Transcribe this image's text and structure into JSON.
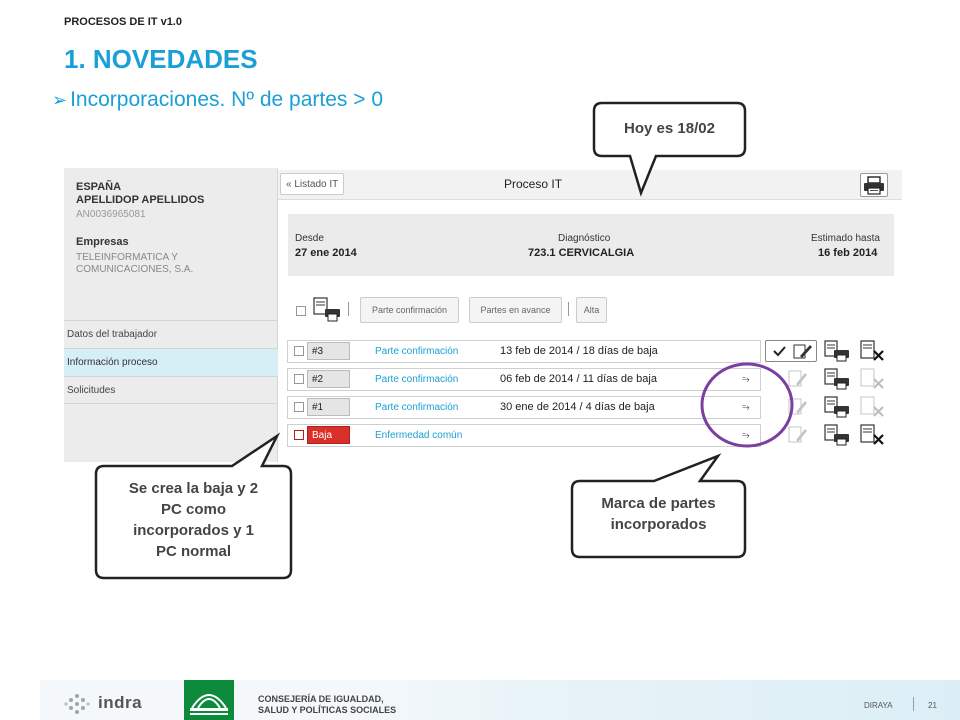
{
  "slide": {
    "doc_label": "PROCESOS DE IT v1.0",
    "title": "1. NOVEDADES",
    "bullet": "Incorporaciones. Nº de partes > 0"
  },
  "patient": {
    "country": "ESPAÑA",
    "name": "APELLIDOP APELLIDOS",
    "id": "AN0036965081",
    "company_label": "Empresas",
    "company_name": "TELEINFORMATICA Y COMUNICACIONES, S.A."
  },
  "nav": {
    "items": [
      "Datos del trabajador",
      "Información proceso",
      "Solicitudes"
    ],
    "active_index": 1
  },
  "toolbar": {
    "back_label": "« Listado IT",
    "title": "Proceso IT"
  },
  "summary": {
    "desde_label": "Desde",
    "desde_value": "27 ene 2014",
    "diag_label": "Diagnóstico",
    "diag_value": "723.1 CERVICALGIA",
    "est_label": "Estimado hasta",
    "est_value": "16 feb 2014"
  },
  "actions": {
    "confirm_label": "Parte confirmación",
    "advance_label": "Partes en avance",
    "alta_label": "Alta"
  },
  "rows": [
    {
      "tag": "#3",
      "type": "Parte confirmación",
      "date": "13 feb de 2014 / 18 días de baja",
      "marked": false
    },
    {
      "tag": "#2",
      "type": "Parte confirmación",
      "date": "06 feb de 2014 / 11 días de baja",
      "marked": true
    },
    {
      "tag": "#1",
      "type": "Parte confirmación",
      "date": "30 ene de 2014 / 4 días de baja",
      "marked": true
    },
    {
      "tag": "Baja",
      "type": "Enfermedad común",
      "date": "",
      "marked": true
    }
  ],
  "callouts": {
    "today": "Hoy es 18/02",
    "baja_line1": "Se crea la baja y 2",
    "baja_line2": "PC como",
    "baja_line3": "incorporados y 1",
    "baja_line4": "PC normal",
    "mark_line1": "Marca de partes",
    "mark_line2": "incorporados"
  },
  "footer": {
    "brand": "indra",
    "consejeria_line1": "CONSEJERÍA DE IGUALDAD,",
    "consejeria_line2": "SALUD Y POLÍTICAS SOCIALES",
    "diraya": "DIRAYA",
    "page": "21"
  },
  "colors": {
    "accent": "#1a9fd6",
    "baja_red": "#d9302a",
    "circle": "#7b3fa0",
    "junta_green": "#0d8a3c"
  }
}
